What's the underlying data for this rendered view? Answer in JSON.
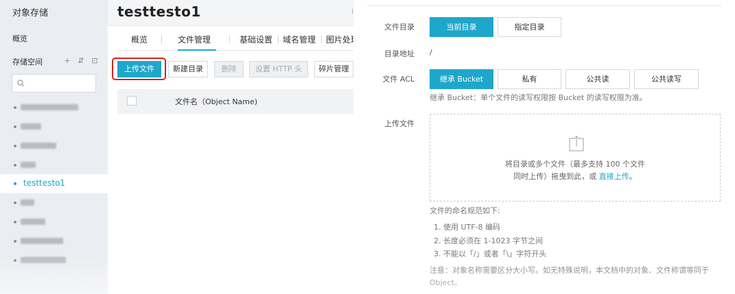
{
  "sidebar": {
    "title": "对象存储",
    "overview": "概览",
    "storage_space": "存储空间",
    "actions": [
      "+",
      "⇵",
      "⊡"
    ],
    "active_bucket": "testtesto1"
  },
  "middle": {
    "bucket_title": "testtesto1",
    "truncated_right": "i",
    "tabs": [
      "概览",
      "文件管理",
      "基础设置",
      "域名管理",
      "图片处理"
    ],
    "active_tab": "文件管理",
    "buttons": {
      "upload": "上传文件",
      "new_dir": "新建目录",
      "delete": "删除",
      "set_http": "设置 HTTP 头",
      "fragment": "碎片管理"
    },
    "table_header": "文件名（Object Name)"
  },
  "right": {
    "dir_label": "文件目录",
    "dir_options": [
      "当前目录",
      "指定目录"
    ],
    "dir_selected": "当前目录",
    "address_label": "目录地址",
    "address_value": "/",
    "acl_label": "文件 ACL",
    "acl_options": [
      "继承 Bucket",
      "私有",
      "公共读",
      "公共读写"
    ],
    "acl_selected": "继承 Bucket",
    "acl_hint": "继承 Bucket：单个文件的读写权限按 Bucket 的读写权限为准。",
    "upload_label": "上传文件",
    "drop_line1": "将目录或多个文件（最多支持 100 个文件",
    "drop_line2_prefix": "同时上传）拖曳到此，或 ",
    "drop_link": "直接上传",
    "drop_line2_suffix": "。",
    "rules_title": "文件的命名规范如下:",
    "rules": [
      "1. 使用 UTF-8 编码",
      "2. 长度必须在 1-1023 字节之间",
      "3. 不能以「/」或者「\\」字符开头"
    ],
    "note": "注意：对象名称需要区分大小写。如无特殊说明，本文档中的对象、文件称谓等同于 Object。"
  },
  "colors": {
    "accent": "#1ea7ca",
    "highlight_border": "#e01b1b",
    "sidebar_bg": "#eaedf1"
  },
  "icons": {
    "search": "search-icon",
    "upload": "upload-icon",
    "add": "plus-icon",
    "sort": "sort-icon",
    "refresh": "expand-icon"
  }
}
